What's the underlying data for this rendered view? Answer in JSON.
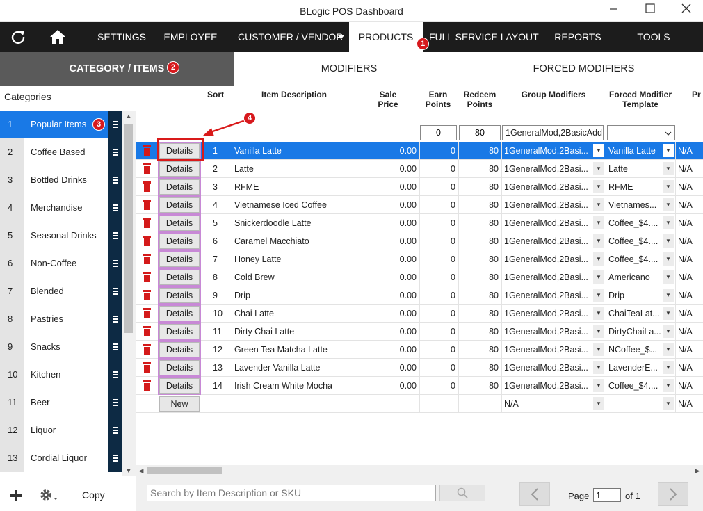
{
  "window": {
    "title": "BLogic POS Dashboard"
  },
  "nav": {
    "items": [
      "SETTINGS",
      "EMPLOYEE",
      "CUSTOMER / VENDOR",
      "PRODUCTS",
      "FULL SERVICE LAYOUT",
      "REPORTS",
      "TOOLS"
    ],
    "active": "PRODUCTS"
  },
  "subtabs": [
    "CATEGORY / ITEMS",
    "MODIFIERS",
    "FORCED MODIFIERS"
  ],
  "badges": [
    "1",
    "2",
    "3",
    "4"
  ],
  "sidebar": {
    "header": "Categories",
    "categories": [
      {
        "num": "1",
        "name": "Popular Items"
      },
      {
        "num": "2",
        "name": "Coffee Based"
      },
      {
        "num": "3",
        "name": "Bottled Drinks"
      },
      {
        "num": "4",
        "name": "Merchandise"
      },
      {
        "num": "5",
        "name": "Seasonal Drinks"
      },
      {
        "num": "6",
        "name": "Non-Coffee"
      },
      {
        "num": "7",
        "name": "Blended"
      },
      {
        "num": "8",
        "name": "Pastries"
      },
      {
        "num": "9",
        "name": "Snacks"
      },
      {
        "num": "10",
        "name": "Kitchen"
      },
      {
        "num": "11",
        "name": "Beer"
      },
      {
        "num": "12",
        "name": "Liquor"
      },
      {
        "num": "13",
        "name": "Cordial Liquor"
      }
    ],
    "footer": {
      "copy_label": "Copy"
    }
  },
  "grid": {
    "headers": {
      "sort": "Sort",
      "description": "Item Description",
      "sale_price": "Sale Price",
      "earn_points": "Earn Points",
      "redeem_points": "Redeem Points",
      "group_modifiers": "Group Modifiers",
      "forced_modifier_template": "Forced Modifier Template",
      "extra": "Pr"
    },
    "filters": {
      "earn": "0",
      "redeem": "80",
      "group": "1GeneralMod,2BasicAdd",
      "forced": ""
    },
    "details_label": "Details",
    "new_label": "New",
    "rows": [
      {
        "sort": "1",
        "desc": "Vanilla Latte",
        "price": "0.00",
        "earn": "0",
        "redeem": "80",
        "group": "1GeneralMod,2Basi...",
        "forced": "Vanilla Latte",
        "extra": "N/A"
      },
      {
        "sort": "2",
        "desc": "Latte",
        "price": "0.00",
        "earn": "0",
        "redeem": "80",
        "group": "1GeneralMod,2Basi...",
        "forced": "Latte",
        "extra": "N/A"
      },
      {
        "sort": "3",
        "desc": "RFME",
        "price": "0.00",
        "earn": "0",
        "redeem": "80",
        "group": "1GeneralMod,2Basi...",
        "forced": "RFME",
        "extra": "N/A"
      },
      {
        "sort": "4",
        "desc": "Vietnamese Iced Coffee",
        "price": "0.00",
        "earn": "0",
        "redeem": "80",
        "group": "1GeneralMod,2Basi...",
        "forced": "Vietnames...",
        "extra": "N/A"
      },
      {
        "sort": "5",
        "desc": "Snickerdoodle Latte",
        "price": "0.00",
        "earn": "0",
        "redeem": "80",
        "group": "1GeneralMod,2Basi...",
        "forced": "Coffee_$4....",
        "extra": "N/A"
      },
      {
        "sort": "6",
        "desc": "Caramel Macchiato",
        "price": "0.00",
        "earn": "0",
        "redeem": "80",
        "group": "1GeneralMod,2Basi...",
        "forced": "Coffee_$4....",
        "extra": "N/A"
      },
      {
        "sort": "7",
        "desc": "Honey Latte",
        "price": "0.00",
        "earn": "0",
        "redeem": "80",
        "group": "1GeneralMod,2Basi...",
        "forced": "Coffee_$4....",
        "extra": "N/A"
      },
      {
        "sort": "8",
        "desc": "Cold Brew",
        "price": "0.00",
        "earn": "0",
        "redeem": "80",
        "group": "1GeneralMod,2Basi...",
        "forced": "Americano",
        "extra": "N/A"
      },
      {
        "sort": "9",
        "desc": "Drip",
        "price": "0.00",
        "earn": "0",
        "redeem": "80",
        "group": "1GeneralMod,2Basi...",
        "forced": "Drip",
        "extra": "N/A"
      },
      {
        "sort": "10",
        "desc": "Chai Latte",
        "price": "0.00",
        "earn": "0",
        "redeem": "80",
        "group": "1GeneralMod,2Basi...",
        "forced": "ChaiTeaLat...",
        "extra": "N/A"
      },
      {
        "sort": "11",
        "desc": "Dirty Chai Latte",
        "price": "0.00",
        "earn": "0",
        "redeem": "80",
        "group": "1GeneralMod,2Basi...",
        "forced": "DirtyChaiLa...",
        "extra": "N/A"
      },
      {
        "sort": "12",
        "desc": "Green Tea Matcha Latte",
        "price": "0.00",
        "earn": "0",
        "redeem": "80",
        "group": "1GeneralMod,2Basi...",
        "forced": "NCoffee_$...",
        "extra": "N/A"
      },
      {
        "sort": "13",
        "desc": "Lavender Vanilla Latte",
        "price": "0.00",
        "earn": "0",
        "redeem": "80",
        "group": "1GeneralMod,2Basi...",
        "forced": "LavenderE...",
        "extra": "N/A"
      },
      {
        "sort": "14",
        "desc": "Irish Cream White Mocha",
        "price": "0.00",
        "earn": "0",
        "redeem": "80",
        "group": "1GeneralMod,2Basi...",
        "forced": "Coffee_$4....",
        "extra": "N/A"
      }
    ],
    "new_row": {
      "group": "N/A",
      "extra": "N/A"
    }
  },
  "search": {
    "placeholder": "Search by Item Description or SKU"
  },
  "pagination": {
    "page_label": "Page",
    "current": "1",
    "of_label": "of 1"
  },
  "colors": {
    "accent": "#1979e6",
    "nav_bg": "#1c1c1c",
    "badge": "#d7191d",
    "highlight": "#d91a1a",
    "drag_bg": "#0d2a44"
  }
}
